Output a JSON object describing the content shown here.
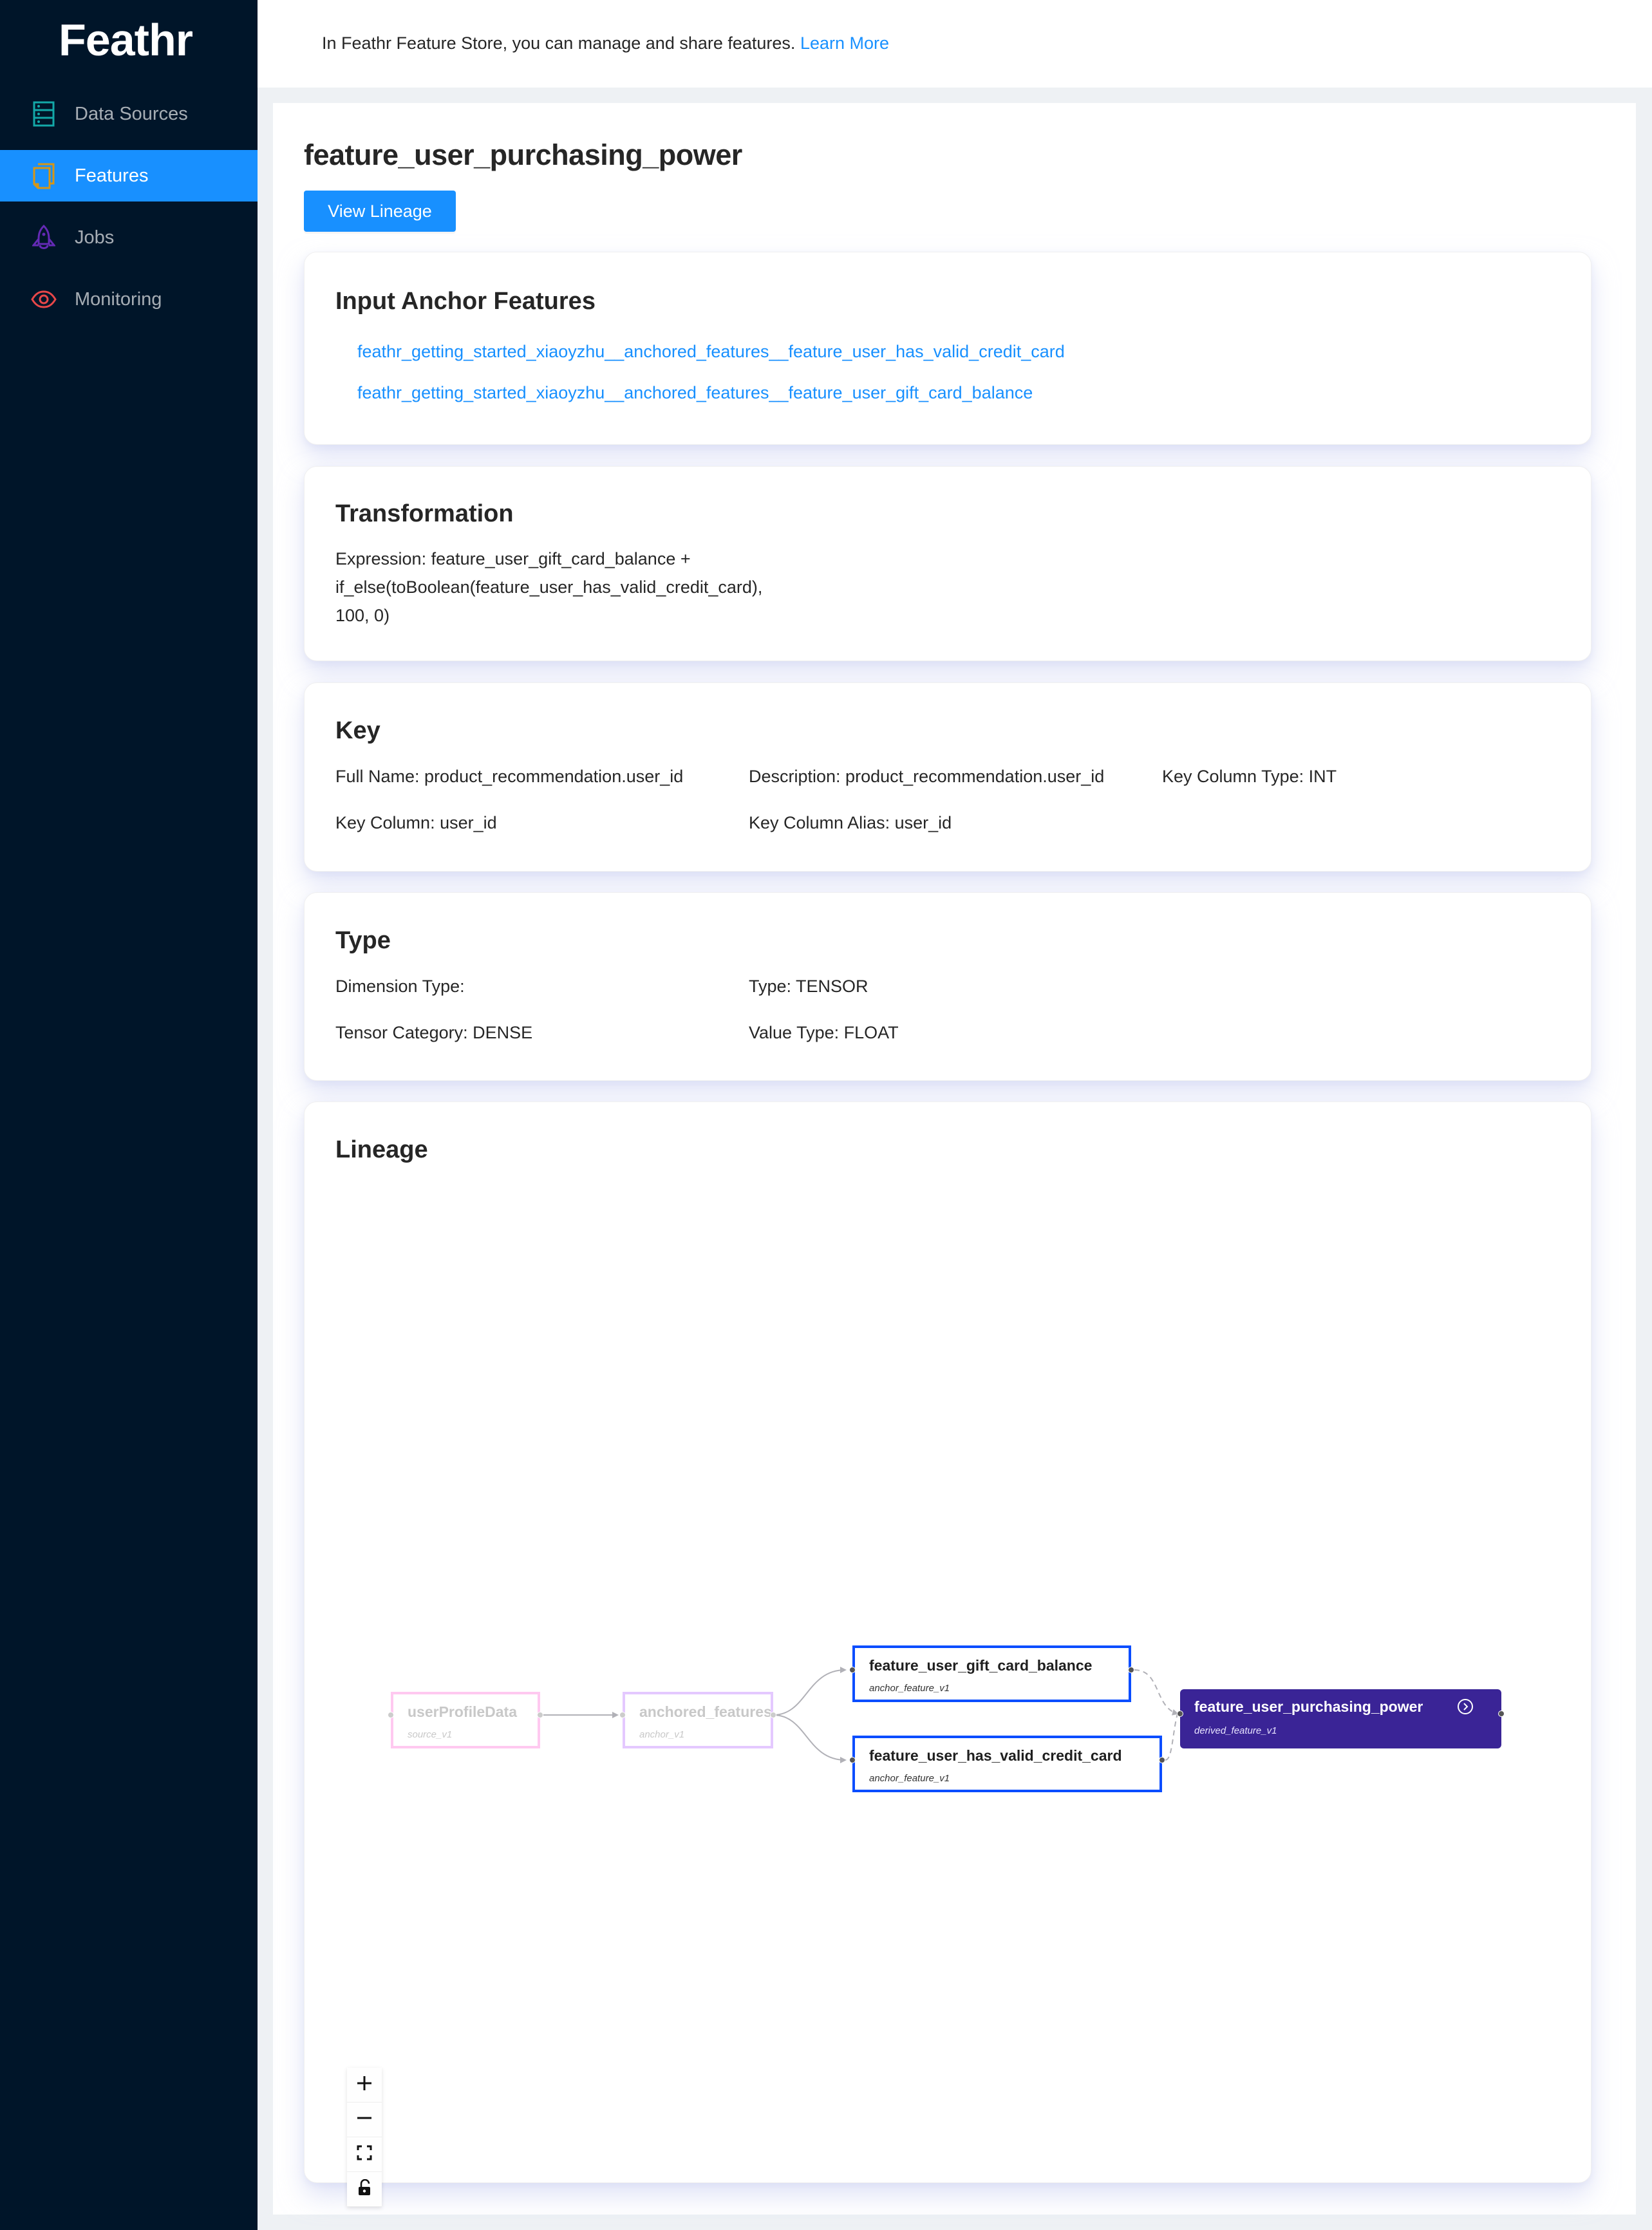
{
  "app": {
    "logo": "Feathr"
  },
  "sidebar": {
    "items": [
      {
        "label": "Data Sources",
        "icon": "database-icon",
        "color": "#13a8a8",
        "active": false
      },
      {
        "label": "Features",
        "icon": "copy-icon",
        "color": "#d89614",
        "active": true
      },
      {
        "label": "Jobs",
        "icon": "rocket-icon",
        "color": "#642ab5",
        "active": false
      },
      {
        "label": "Monitoring",
        "icon": "eye-icon",
        "color": "#e84749",
        "active": false
      }
    ]
  },
  "header": {
    "text": "In Feathr Feature Store, you can manage and share features.",
    "link": "Learn More"
  },
  "page": {
    "title": "feature_user_purchasing_power",
    "view_lineage_label": "View Lineage"
  },
  "input_anchor_features": {
    "title": "Input Anchor Features",
    "links": [
      "feathr_getting_started_xiaoyzhu__anchored_features__feature_user_has_valid_credit_card",
      "feathr_getting_started_xiaoyzhu__anchored_features__feature_user_gift_card_balance"
    ]
  },
  "transformation": {
    "title": "Transformation",
    "lines": [
      "Expression: feature_user_gift_card_balance +",
      "if_else(toBoolean(feature_user_has_valid_credit_card),",
      "100, 0)"
    ]
  },
  "key": {
    "title": "Key",
    "full_name": "Full Name: product_recommendation.user_id",
    "description": "Description: product_recommendation.user_id",
    "key_column_type": "Key Column Type: INT",
    "key_column": "Key Column: user_id",
    "key_column_alias": "Key Column Alias: user_id"
  },
  "type": {
    "title": "Type",
    "dimension_type": "Dimension Type:",
    "type": "Type: TENSOR",
    "tensor_category": "Tensor Category: DENSE",
    "value_type": "Value Type: FLOAT"
  },
  "lineage": {
    "title": "Lineage",
    "nodes": [
      {
        "id": "source",
        "title": "userProfileData",
        "subtitle": "source_v1",
        "kind": "source",
        "color": "#ffc9f0"
      },
      {
        "id": "anchor",
        "title": "anchored_features",
        "subtitle": "anchor_v1",
        "kind": "anchor-group",
        "color": "#e4c9ff"
      },
      {
        "id": "gift",
        "title": "feature_user_gift_card_balance",
        "subtitle": "anchor_feature_v1",
        "kind": "anchor-feature",
        "color": "#0a4dff"
      },
      {
        "id": "credit",
        "title": "feature_user_has_valid_credit_card",
        "subtitle": "anchor_feature_v1",
        "kind": "anchor-feature",
        "color": "#0a4dff"
      },
      {
        "id": "derived",
        "title": "feature_user_purchasing_power",
        "subtitle": "derived_feature_v1",
        "kind": "derived-feature",
        "color": "#3a2496"
      }
    ],
    "edges": [
      {
        "from": "source",
        "to": "anchor",
        "style": "solid"
      },
      {
        "from": "anchor",
        "to": "gift",
        "style": "solid"
      },
      {
        "from": "anchor",
        "to": "credit",
        "style": "solid"
      },
      {
        "from": "gift",
        "to": "derived",
        "style": "dashed"
      },
      {
        "from": "credit",
        "to": "derived",
        "style": "dashed"
      }
    ],
    "controls": [
      "zoom-in",
      "zoom-out",
      "fit-view",
      "lock"
    ]
  }
}
